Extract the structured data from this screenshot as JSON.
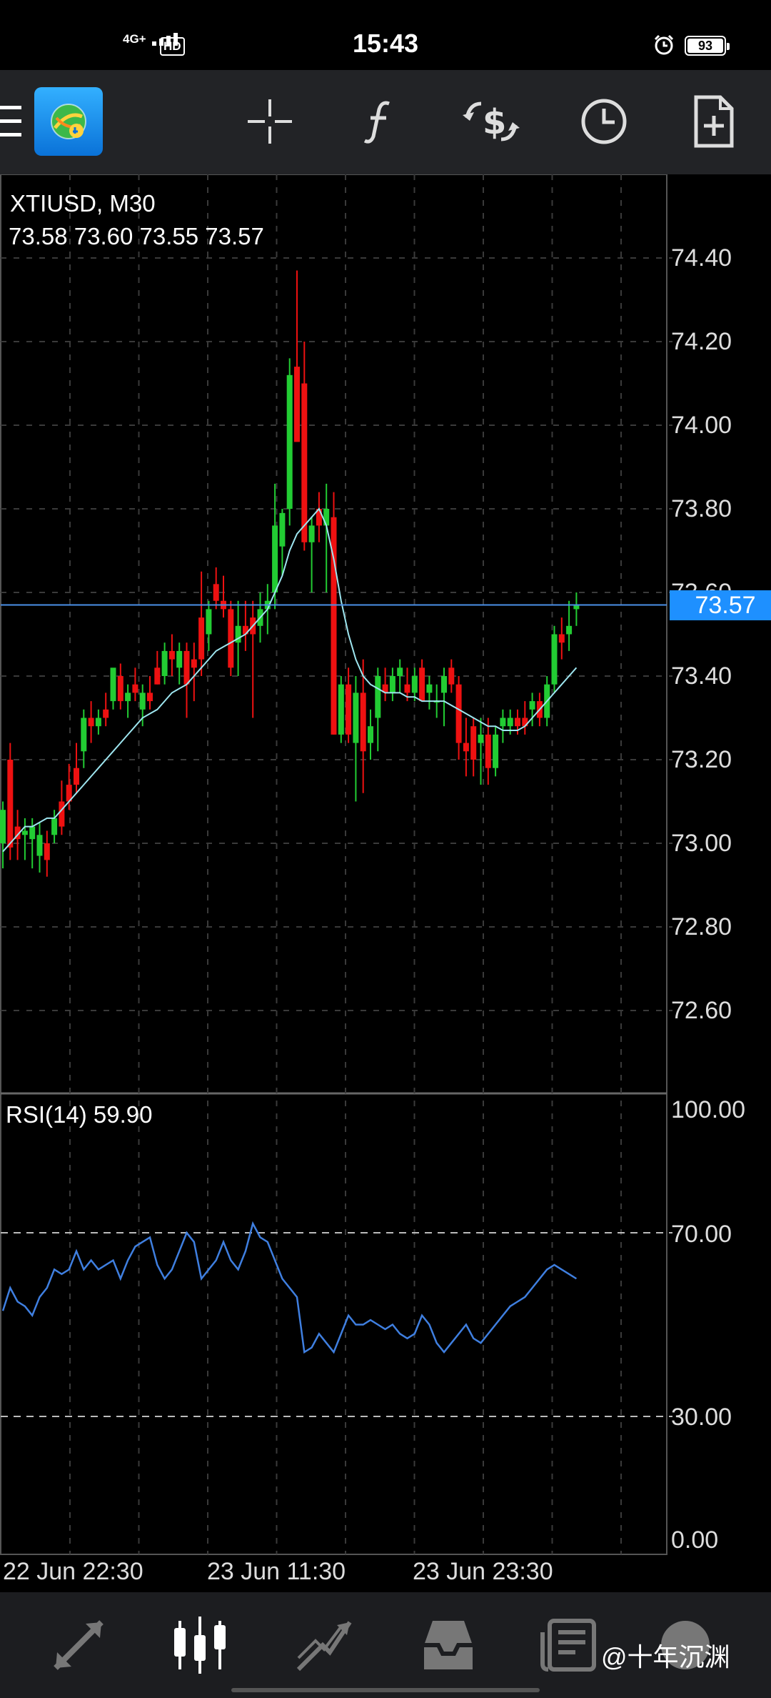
{
  "status_bar": {
    "time": "15:43",
    "network": "4G+",
    "hd": "HD",
    "battery": "93"
  },
  "toolbar": {
    "icons": [
      "menu-icon",
      "mt4-logo",
      "crosshair-icon",
      "function-icon",
      "currency-exchange-icon",
      "clock-icon",
      "new-order-icon"
    ]
  },
  "chart": {
    "symbol_timeframe": "XTIUSD, M30",
    "ohlc": "73.58 73.60 73.55 73.57",
    "current_price": "73.57",
    "price_axis": [
      "74.40",
      "74.20",
      "74.00",
      "73.80",
      "73.60",
      "73.40",
      "73.20",
      "73.00",
      "72.80",
      "72.60"
    ],
    "time_axis": [
      "22 Jun 22:30",
      "23 Jun 11:30",
      "23 Jun 23:30"
    ],
    "rsi_label": "RSI(14) 59.90",
    "rsi_axis": [
      "100.00",
      "70.00",
      "30.00",
      "0.00"
    ],
    "colors": {
      "bull": "#22cc33",
      "bear": "#ee1111",
      "ma": "#9ee6f0",
      "rsi": "#3f7fe0",
      "price_line": "#4a8fe8"
    }
  },
  "bottom_nav": {
    "items": [
      "quotes-icon",
      "chart-icon",
      "trade-icon",
      "history-icon",
      "news-icon",
      "messages-icon"
    ]
  },
  "watermark": "@十年沉渊",
  "chart_data": {
    "type": "candlestick",
    "title": "XTIUSD, M30",
    "ylim": [
      72.45,
      74.65
    ],
    "candles": [
      [
        73.0,
        73.1,
        72.94,
        73.08
      ],
      [
        73.2,
        73.24,
        72.96,
        72.99
      ],
      [
        73.04,
        73.08,
        72.96,
        73.01
      ],
      [
        73.02,
        73.06,
        72.96,
        73.03
      ],
      [
        73.01,
        73.06,
        72.94,
        73.04
      ],
      [
        72.97,
        73.05,
        72.93,
        73.02
      ],
      [
        73.0,
        73.03,
        72.92,
        72.96
      ],
      [
        73.02,
        73.08,
        73.0,
        73.06
      ],
      [
        73.1,
        73.15,
        73.02,
        73.04
      ],
      [
        73.14,
        73.19,
        73.08,
        73.1
      ],
      [
        73.18,
        73.24,
        73.12,
        73.14
      ],
      [
        73.22,
        73.32,
        73.18,
        73.3
      ],
      [
        73.3,
        73.34,
        73.24,
        73.28
      ],
      [
        73.28,
        73.32,
        73.26,
        73.3
      ],
      [
        73.32,
        73.36,
        73.28,
        73.3
      ],
      [
        73.34,
        73.4,
        73.32,
        73.42
      ],
      [
        73.4,
        73.43,
        73.32,
        73.34
      ],
      [
        73.34,
        73.38,
        73.3,
        73.36
      ],
      [
        73.38,
        73.42,
        73.34,
        73.36
      ],
      [
        73.32,
        73.38,
        73.28,
        73.36
      ],
      [
        73.36,
        73.4,
        73.32,
        73.34
      ],
      [
        73.42,
        73.46,
        73.38,
        73.38
      ],
      [
        73.4,
        73.48,
        73.38,
        73.46
      ],
      [
        73.46,
        73.5,
        73.4,
        73.44
      ],
      [
        73.42,
        73.48,
        73.38,
        73.46
      ],
      [
        73.46,
        73.48,
        73.3,
        73.38
      ],
      [
        73.44,
        73.48,
        73.34,
        73.42
      ],
      [
        73.54,
        73.65,
        73.4,
        73.44
      ],
      [
        73.5,
        73.58,
        73.46,
        73.56
      ],
      [
        73.62,
        73.66,
        73.56,
        73.58
      ],
      [
        73.58,
        73.64,
        73.54,
        73.56
      ],
      [
        73.56,
        73.58,
        73.4,
        73.42
      ],
      [
        73.48,
        73.58,
        73.4,
        73.52
      ],
      [
        73.52,
        73.58,
        73.46,
        73.5
      ],
      [
        73.54,
        73.58,
        73.3,
        73.5
      ],
      [
        73.52,
        73.6,
        73.48,
        73.56
      ],
      [
        73.56,
        73.62,
        73.5,
        73.58
      ],
      [
        73.6,
        73.86,
        73.56,
        73.76
      ],
      [
        73.71,
        73.8,
        73.64,
        73.79
      ],
      [
        73.8,
        74.16,
        73.76,
        74.12
      ],
      [
        74.14,
        74.37,
        74.0,
        73.96
      ],
      [
        74.1,
        74.2,
        73.7,
        73.72
      ],
      [
        73.72,
        73.78,
        73.6,
        73.76
      ],
      [
        73.8,
        73.84,
        73.72,
        73.76
      ],
      [
        73.76,
        73.86,
        73.6,
        73.8
      ],
      [
        73.78,
        73.84,
        73.26,
        73.26
      ],
      [
        73.26,
        73.4,
        73.24,
        73.38
      ],
      [
        73.38,
        73.42,
        73.24,
        73.26
      ],
      [
        73.24,
        73.4,
        73.1,
        73.36
      ],
      [
        73.36,
        73.44,
        73.12,
        73.22
      ],
      [
        73.24,
        73.32,
        73.2,
        73.28
      ],
      [
        73.3,
        73.42,
        73.22,
        73.4
      ],
      [
        73.38,
        73.42,
        73.34,
        73.36
      ],
      [
        73.36,
        73.42,
        73.34,
        73.4
      ],
      [
        73.4,
        73.44,
        73.36,
        73.42
      ],
      [
        73.38,
        73.42,
        73.34,
        73.36
      ],
      [
        73.36,
        73.42,
        73.34,
        73.4
      ],
      [
        73.42,
        73.44,
        73.34,
        73.34
      ],
      [
        73.36,
        73.4,
        73.32,
        73.38
      ],
      [
        73.34,
        73.38,
        73.3,
        73.34
      ],
      [
        73.36,
        73.42,
        73.28,
        73.4
      ],
      [
        73.42,
        73.44,
        73.36,
        73.38
      ],
      [
        73.38,
        73.4,
        73.2,
        73.24
      ],
      [
        73.24,
        73.3,
        73.16,
        73.22
      ],
      [
        73.28,
        73.3,
        73.16,
        73.2
      ],
      [
        73.24,
        73.3,
        73.14,
        73.26
      ],
      [
        73.26,
        73.3,
        73.14,
        73.18
      ],
      [
        73.18,
        73.28,
        73.16,
        73.26
      ],
      [
        73.28,
        73.32,
        73.24,
        73.3
      ],
      [
        73.28,
        73.32,
        73.26,
        73.3
      ],
      [
        73.3,
        73.32,
        73.26,
        73.28
      ],
      [
        73.3,
        73.34,
        73.26,
        73.28
      ],
      [
        73.32,
        73.36,
        73.28,
        73.34
      ],
      [
        73.34,
        73.36,
        73.28,
        73.3
      ],
      [
        73.3,
        73.4,
        73.28,
        73.38
      ],
      [
        73.38,
        73.52,
        73.36,
        73.5
      ],
      [
        73.5,
        73.54,
        73.44,
        73.48
      ],
      [
        73.5,
        73.58,
        73.46,
        73.52
      ],
      [
        73.56,
        73.6,
        73.52,
        73.57
      ]
    ],
    "ma": [
      72.98,
      73.0,
      73.02,
      73.04,
      73.04,
      73.05,
      73.06,
      73.06,
      73.08,
      73.1,
      73.12,
      73.14,
      73.16,
      73.18,
      73.2,
      73.22,
      73.24,
      73.26,
      73.28,
      73.3,
      73.31,
      73.32,
      73.34,
      73.36,
      73.37,
      73.38,
      73.4,
      73.42,
      73.44,
      73.46,
      73.47,
      73.48,
      73.49,
      73.5,
      73.52,
      73.54,
      73.56,
      73.6,
      73.64,
      73.7,
      73.74,
      73.76,
      73.78,
      73.8,
      73.76,
      73.68,
      73.58,
      73.5,
      73.44,
      73.4,
      73.38,
      73.37,
      73.36,
      73.36,
      73.36,
      73.35,
      73.35,
      73.34,
      73.34,
      73.34,
      73.34,
      73.33,
      73.32,
      73.31,
      73.3,
      73.29,
      73.28,
      73.28,
      73.27,
      73.27,
      73.27,
      73.28,
      73.3,
      73.32,
      73.34,
      73.36,
      73.38,
      73.4,
      73.42
    ],
    "rsi": [
      53,
      58,
      55,
      54,
      52,
      56,
      58,
      62,
      61,
      62,
      66,
      62,
      64,
      62,
      63,
      64,
      60,
      64,
      67,
      68,
      69,
      63,
      60,
      62,
      66,
      70,
      68,
      60,
      62,
      64,
      68,
      64,
      62,
      66,
      72,
      69,
      68,
      64,
      60,
      58,
      56,
      44,
      45,
      48,
      46,
      44,
      48,
      52,
      50,
      50,
      51,
      50,
      49,
      50,
      48,
      47,
      48,
      52,
      50,
      46,
      44,
      46,
      48,
      50,
      47,
      46,
      48,
      50,
      52,
      54,
      55,
      56,
      58,
      60,
      62,
      63,
      62,
      61,
      60
    ],
    "price_levels": [
      74.4,
      74.2,
      74.0,
      73.8,
      73.6,
      73.4,
      73.2,
      73.0,
      72.8,
      72.6
    ],
    "rsi_levels": [
      70,
      30
    ]
  }
}
